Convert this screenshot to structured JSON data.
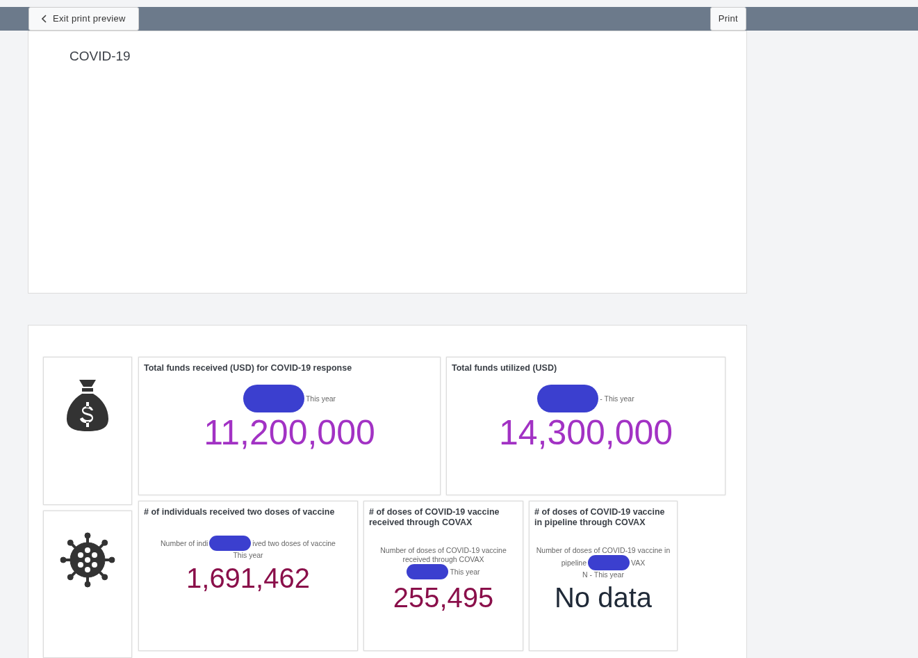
{
  "toolbar": {
    "back_button": "Exit print preview",
    "print_button": "Print"
  },
  "report_title": "COVID-19",
  "icon_tiles": [
    {
      "kind": "money"
    },
    {
      "kind": "virus"
    }
  ],
  "top_cards": [
    {
      "title": "Total funds received (USD) for COVID-19 response",
      "caption_lines": [
        [
          {
            "kind": "redaction"
          },
          {
            "kind": "text",
            "text": "This year"
          }
        ]
      ],
      "value": "11,200,000",
      "color": "#a232c4"
    },
    {
      "title": "Total funds utilized (USD)",
      "caption_lines": [
        [
          {
            "kind": "redaction"
          },
          {
            "kind": "text",
            "text": "- This year"
          }
        ]
      ],
      "value": "14,300,000",
      "color": "#a232c4"
    }
  ],
  "bottom_cards": [
    {
      "title": "# of individuals received two doses of vaccine",
      "caption_lines": [
        [
          {
            "kind": "text",
            "text": "Number of indi"
          },
          {
            "kind": "redaction"
          },
          {
            "kind": "text",
            "text": "ived two doses of vaccine"
          }
        ],
        [
          {
            "kind": "text",
            "text": "This year"
          }
        ]
      ],
      "value": "1,691,462",
      "color": "#8a0f4a"
    },
    {
      "title": "# of doses of COVID-19 vaccine received through COVAX",
      "caption_lines": [
        [
          {
            "kind": "text",
            "text": "Number of doses of COVID-19 vaccine"
          }
        ],
        [
          {
            "kind": "text",
            "text": "received through COVAX"
          }
        ],
        [
          {
            "kind": "redaction"
          },
          {
            "kind": "text",
            "text": "This year"
          }
        ]
      ],
      "value": "255,495",
      "color": "#8a0f4a"
    },
    {
      "title": "# of doses of COVID-19 vaccine in pipeline through COVAX",
      "caption_lines": [
        [
          {
            "kind": "text",
            "text": "Number of doses of COVID-19 vaccine in"
          }
        ],
        [
          {
            "kind": "text",
            "text": "pipeline"
          },
          {
            "kind": "redaction"
          },
          {
            "kind": "text",
            "text": "VAX"
          }
        ],
        [
          {
            "kind": "text",
            "text": "N - This year"
          }
        ]
      ],
      "value": "No data",
      "color": "#1f2937"
    }
  ]
}
